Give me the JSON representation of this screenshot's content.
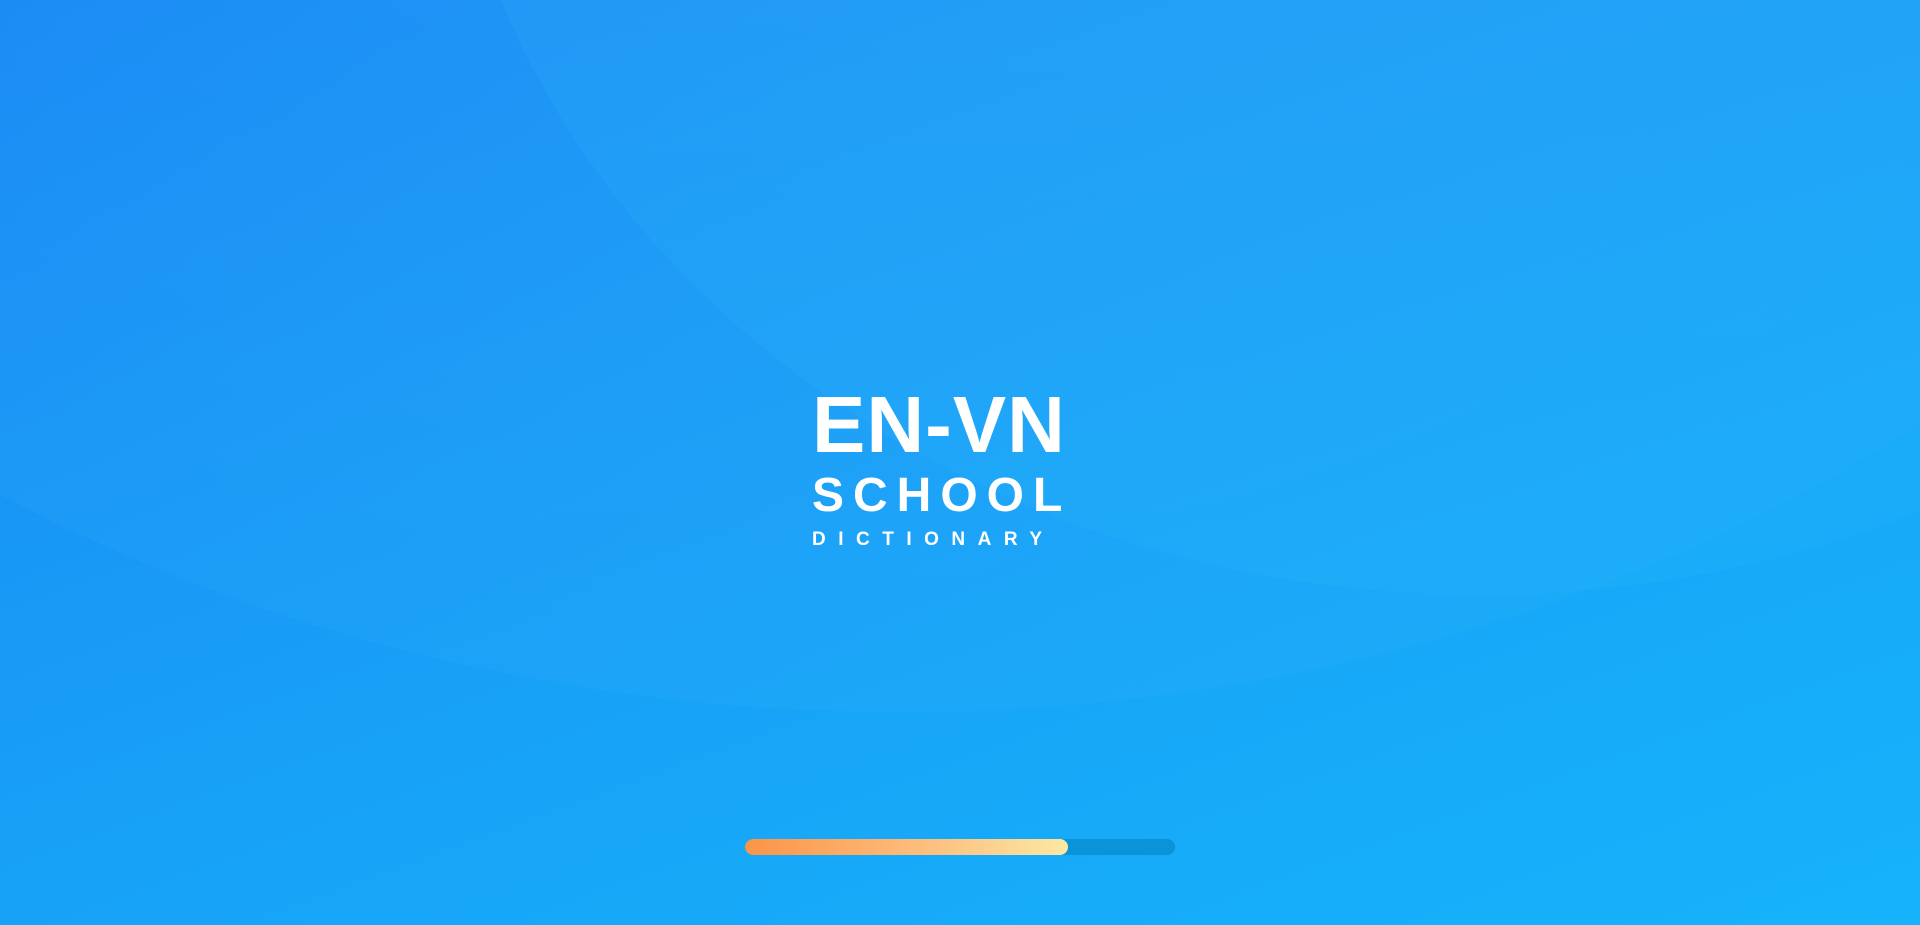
{
  "logo": {
    "line1": "EN-VN",
    "line2": "SCHOOL",
    "line3": "DICTIONARY"
  },
  "loading": {
    "progress_percent": 75
  },
  "colors": {
    "background_start": "#1584f4",
    "background_end": "#16b3fb",
    "progress_track": "#0a93d6",
    "progress_fill_start": "#fb9448",
    "progress_fill_end": "#fde8a4",
    "logo_text": "#ffffff"
  }
}
